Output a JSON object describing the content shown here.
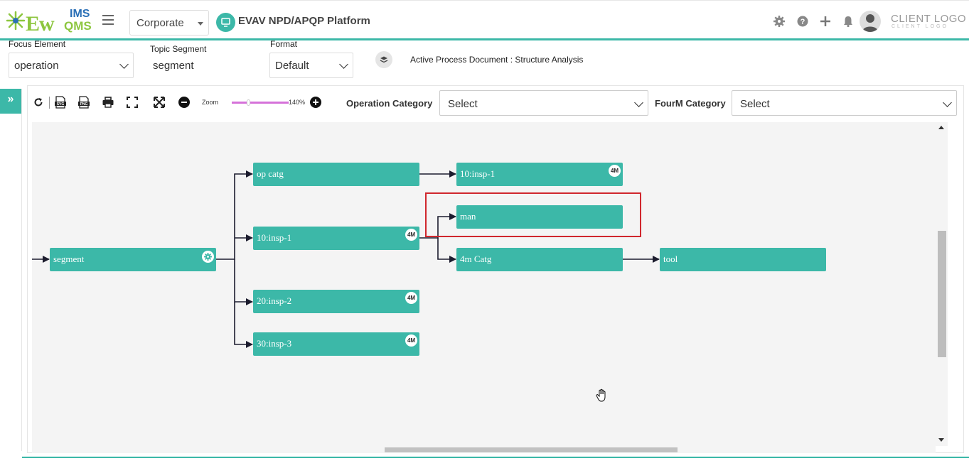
{
  "header": {
    "logo": {
      "ew": "Ew",
      "ims": "IMS",
      "qms": "QMS"
    },
    "company_select": "Corporate",
    "platform_title": "EVAV NPD/APQP Platform",
    "icons": [
      "gear-icon",
      "help-icon",
      "plus-icon",
      "bell-icon",
      "user-avatar-icon"
    ],
    "client_logo": "CLIENT LOGO",
    "client_logo_sub": "CLIENT LOGO"
  },
  "filters": {
    "focus_element": {
      "label": "Focus Element",
      "value": "operation"
    },
    "topic_segment": {
      "label": "Topic Segment",
      "value": "segment"
    },
    "format": {
      "label": "Format",
      "value": "Default"
    },
    "active_doc": "Active Process Document : Structure Analysis"
  },
  "toolbar": {
    "icons": [
      "refresh-icon",
      "svg-export-icon",
      "png-export-icon",
      "print-icon",
      "fullscreen-icon",
      "fit-icon",
      "zoom-out-icon",
      "zoom-in-icon"
    ],
    "zoom_label": "Zoom",
    "zoom_value": "140%",
    "zoom_level": 140,
    "operation_category": {
      "label": "Operation Category",
      "value": "Select"
    },
    "fourm_category": {
      "label": "FourM Category",
      "value": "Select"
    }
  },
  "diagram": {
    "nodes": {
      "segment": {
        "label": "segment",
        "badge": "gear"
      },
      "op_catg": {
        "label": "op catg"
      },
      "op_insp1": {
        "label": "10:insp-1",
        "badge": "4M"
      },
      "op_insp2": {
        "label": "20:insp-2",
        "badge": "4M"
      },
      "op_insp3": {
        "label": "30:insp-3",
        "badge": "4M"
      },
      "catg_insp1": {
        "label": "10:insp-1",
        "badge": "4M"
      },
      "man": {
        "label": "man"
      },
      "m4_catg": {
        "label": "4m Catg"
      },
      "tool": {
        "label": "tool"
      }
    },
    "edges": [
      [
        "segment",
        "op_catg"
      ],
      [
        "segment",
        "op_insp1"
      ],
      [
        "segment",
        "op_insp2"
      ],
      [
        "segment",
        "op_insp3"
      ],
      [
        "op_catg",
        "catg_insp1"
      ],
      [
        "op_insp1",
        "man"
      ],
      [
        "op_insp1",
        "m4_catg"
      ],
      [
        "m4_catg",
        "tool"
      ]
    ],
    "highlighted_node": "man"
  },
  "colors": {
    "accent": "#3cb8a8",
    "highlight": "#d0272d",
    "zoom_track": "#d572d9"
  }
}
